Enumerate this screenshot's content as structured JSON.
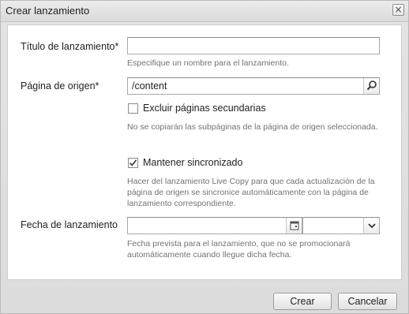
{
  "dialog": {
    "title": "Crear lanzamiento",
    "close_glyph": "×"
  },
  "form": {
    "launch_title": {
      "label": "Título de lanzamiento*",
      "value": "",
      "hint": "Especifique un nombre para el lanzamiento."
    },
    "source_page": {
      "label": "Página de origen*",
      "value": "/content",
      "browse_icon": "search-icon"
    },
    "exclude_subpages": {
      "label": "Excluir páginas secundarias",
      "checked": false,
      "hint": "No se copiarán las subpáginas de la página de origen seleccionada."
    },
    "keep_synced": {
      "label": "Mantener sincronizado",
      "checked": true,
      "hint": "Hacer del lanzamiento Live Copy para que cada actualización de la página de origen se sincronice automáticamente con la página de lanzamiento correspondiente."
    },
    "launch_date": {
      "label": "Fecha de lanzamiento",
      "date_value": "",
      "time_value": "",
      "calendar_icon": "calendar-icon",
      "dropdown_icon": "chevron-down-icon",
      "hint": "Fecha prevista para el lanzamiento, que no se promocionará automáticamente cuando llegue dicha fecha."
    }
  },
  "buttons": {
    "create": "Crear",
    "cancel": "Cancelar"
  },
  "colors": {
    "chrome": "#dcdcdc",
    "panel": "#ffffff",
    "hint_text": "#737373"
  }
}
